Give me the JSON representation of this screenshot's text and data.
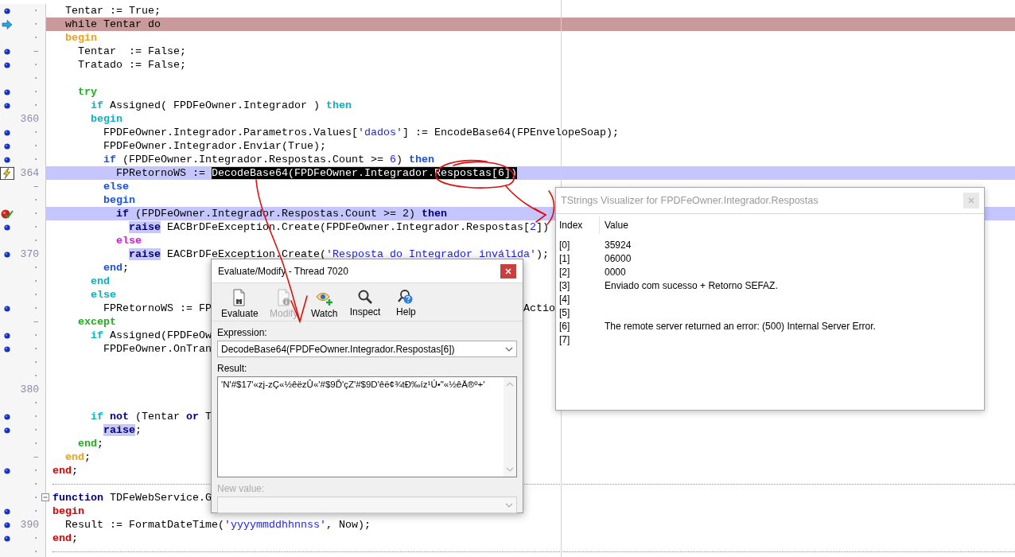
{
  "editor": {
    "lines": [
      {
        "gutter": "·",
        "marker": {
          "kind": "dot"
        },
        "segments": [
          {
            "text": "  Tentar := True;",
            "kind": "plain"
          }
        ]
      },
      {
        "gutter": "·",
        "marker": {
          "kind": "arrow"
        },
        "current": true,
        "segments": [
          {
            "text": "  while Tentar do",
            "kind": "plain"
          }
        ]
      },
      {
        "gutter": "·",
        "segments": [
          {
            "text": "  begin",
            "kind": "keyword",
            "color": "#f0a020"
          }
        ]
      },
      {
        "gutter": "–",
        "marker": {
          "kind": "dot"
        },
        "segments": [
          {
            "text": "    Tentar  := False;",
            "kind": "plain"
          }
        ]
      },
      {
        "gutter": "·",
        "marker": {
          "kind": "dot"
        },
        "segments": [
          {
            "text": "    Tratado := False;",
            "kind": "plain"
          }
        ]
      },
      {
        "gutter": "·"
      },
      {
        "gutter": "·",
        "marker": {
          "kind": "dot"
        },
        "segments": [
          {
            "text": "    try",
            "kind": "keyword",
            "color": "#20b020"
          }
        ]
      },
      {
        "gutter": "·",
        "marker": {
          "kind": "dot"
        },
        "segments": [
          {
            "text": "      if",
            "kind": "keyword",
            "color": "#10b0c0"
          },
          {
            "text": " Assigned( FPDFeOwner.Integrador ) ",
            "kind": "plain"
          },
          {
            "text": "then",
            "kind": "keyword",
            "color": "#10b0c0"
          }
        ]
      },
      {
        "gutter": "360",
        "segments": [
          {
            "text": "      begin",
            "kind": "keyword",
            "color": "#10b0c0"
          }
        ]
      },
      {
        "gutter": "·",
        "marker": {
          "kind": "dot"
        },
        "segments": [
          {
            "text": "        FPDFeOwner.Integrador.Parametros.Values[",
            "kind": "plain"
          },
          {
            "text": "'dados'",
            "kind": "string"
          },
          {
            "text": "] := EncodeBase64(FPEnvelopeSoap);",
            "kind": "plain"
          }
        ]
      },
      {
        "gutter": "·",
        "marker": {
          "kind": "dot"
        },
        "segments": [
          {
            "text": "        FPDFeOwner.Integrador.Enviar(True);",
            "kind": "plain"
          }
        ]
      },
      {
        "gutter": "·",
        "marker": {
          "kind": "dot"
        },
        "segments": [
          {
            "text": "        if",
            "kind": "keyword",
            "color": "#1a4ff0"
          },
          {
            "text": " (FPDFeOwner.Integrador.Respostas.Count >= ",
            "kind": "plain"
          },
          {
            "text": "6",
            "kind": "number"
          },
          {
            "text": ") ",
            "kind": "plain"
          },
          {
            "text": "then",
            "kind": "keyword",
            "color": "#1a4ff0"
          }
        ]
      },
      {
        "gutter": "364",
        "marker": {
          "kind": "lightning"
        },
        "breakpoint": true,
        "segments": [
          {
            "text": "          FPRetornoWS := ",
            "kind": "plain"
          },
          {
            "text": "DecodeBase64(FPDFeOwner.Integrador.Respostas[6])",
            "kind": "selected"
          }
        ]
      },
      {
        "gutter": "–",
        "segments": [
          {
            "text": "        else",
            "kind": "keyword",
            "color": "#1a4ff0"
          }
        ]
      },
      {
        "gutter": "·",
        "segments": [
          {
            "text": "        begin",
            "kind": "keyword",
            "color": "#1a4ff0"
          }
        ]
      },
      {
        "gutter": "·",
        "marker": {
          "kind": "check"
        },
        "breakpoint": true,
        "segments": [
          {
            "text": "          if",
            "kind": "reserved"
          },
          {
            "text": " (FPDFeOwner.Integrador.Respostas.Count >= 2) ",
            "kind": "plain"
          },
          {
            "text": "then",
            "kind": "reserved"
          }
        ]
      },
      {
        "gutter": "·",
        "marker": {
          "kind": "dot"
        },
        "segments": [
          {
            "text": "            raise",
            "kind": "match"
          },
          {
            "text": " EACBrDFeException.Create(FPDFeOwner.Integrador.Respostas[",
            "kind": "plain"
          },
          {
            "text": "2",
            "kind": "number"
          },
          {
            "text": "])",
            "kind": "plain"
          }
        ]
      },
      {
        "gutter": "·",
        "segments": [
          {
            "text": "          else",
            "kind": "keyword",
            "color": "#d020d0"
          }
        ]
      },
      {
        "gutter": "370",
        "marker": {
          "kind": "dot"
        },
        "segments": [
          {
            "text": "            raise",
            "kind": "match"
          },
          {
            "text": " EACBrDFeException.Create(",
            "kind": "plain"
          },
          {
            "text": "'Resposta do Integrador inválida'",
            "kind": "string"
          },
          {
            "text": ");",
            "kind": "plain"
          }
        ]
      },
      {
        "gutter": "·",
        "segments": [
          {
            "text": "        end",
            "kind": "keyword",
            "color": "#1a4ff0"
          },
          {
            "text": ";",
            "kind": "plain"
          }
        ]
      },
      {
        "gutter": "·",
        "segments": [
          {
            "text": "      end",
            "kind": "keyword",
            "color": "#10b0c0"
          }
        ]
      },
      {
        "gutter": "·",
        "segments": [
          {
            "text": "      else",
            "kind": "keyword",
            "color": "#10b0c0"
          }
        ]
      },
      {
        "gutter": "·",
        "marker": {
          "kind": "dot"
        },
        "segments": [
          {
            "text": "        FPRetornoWS := FP",
            "kind": "plain"
          }
        ],
        "tail": "Actio"
      },
      {
        "gutter": "–",
        "segments": [
          {
            "text": "    except",
            "kind": "keyword",
            "color": "#20b020"
          }
        ]
      },
      {
        "gutter": "·",
        "marker": {
          "kind": "dot"
        },
        "segments": [
          {
            "text": "      if",
            "kind": "keyword",
            "color": "#10b0c0"
          },
          {
            "text": " Assigned(FPDFeOw",
            "kind": "plain"
          }
        ]
      },
      {
        "gutter": "·",
        "marker": {
          "kind": "dot"
        },
        "segments": [
          {
            "text": "        FPDFeOwner.OnTran",
            "kind": "plain"
          }
        ]
      },
      {
        "gutter": "·"
      },
      {
        "gutter": "·"
      },
      {
        "gutter": "380"
      },
      {
        "gutter": "·"
      },
      {
        "gutter": "·",
        "marker": {
          "kind": "dot"
        },
        "segments": [
          {
            "text": "      if",
            "kind": "keyword",
            "color": "#10b0c0"
          },
          {
            "text": " not",
            "kind": "reserved"
          },
          {
            "text": " (Tentar ",
            "kind": "plain"
          },
          {
            "text": "or",
            "kind": "reserved"
          },
          {
            "text": " T",
            "kind": "plain"
          }
        ]
      },
      {
        "gutter": "·",
        "marker": {
          "kind": "dot"
        },
        "segments": [
          {
            "text": "        raise",
            "kind": "match"
          },
          {
            "text": ";",
            "kind": "plain"
          }
        ]
      },
      {
        "gutter": "·",
        "segments": [
          {
            "text": "    end",
            "kind": "keyword",
            "color": "#20b020"
          },
          {
            "text": ";",
            "kind": "plain"
          }
        ]
      },
      {
        "gutter": "–",
        "segments": [
          {
            "text": "  end",
            "kind": "keyword",
            "color": "#f0a020"
          },
          {
            "text": ";",
            "kind": "plain"
          }
        ]
      },
      {
        "gutter": "·",
        "marker": {
          "kind": "dot"
        },
        "segments": [
          {
            "text": "end",
            "kind": "keyword",
            "color": "#e00000"
          },
          {
            "text": ";",
            "kind": "plain"
          }
        ]
      },
      {
        "gutter": "·",
        "separator": true
      },
      {
        "gutter": "·",
        "fold": true,
        "segments": [
          {
            "text": "function",
            "kind": "reserved"
          },
          {
            "text": " TDFeWebService.G",
            "kind": "plain"
          }
        ]
      },
      {
        "gutter": "·",
        "marker": {
          "kind": "dot"
        },
        "segments": [
          {
            "text": "begin",
            "kind": "keyword",
            "color": "#e00000"
          }
        ]
      },
      {
        "gutter": "390",
        "marker": {
          "kind": "dot"
        },
        "segments": [
          {
            "text": "  Result := FormatDateTime(",
            "kind": "plain"
          },
          {
            "text": "'yyyymmddhhnnss'",
            "kind": "string"
          },
          {
            "text": ", Now);",
            "kind": "plain"
          }
        ]
      },
      {
        "gutter": "·",
        "marker": {
          "kind": "dot"
        },
        "segments": [
          {
            "text": "end",
            "kind": "keyword",
            "color": "#e00000"
          },
          {
            "text": ";",
            "kind": "plain"
          }
        ]
      },
      {
        "gutter": "·",
        "separator": true
      }
    ]
  },
  "evaluate_dialog": {
    "title": "Evaluate/Modify - Thread 7020",
    "active": true,
    "toolbar": [
      {
        "label": "Evaluate",
        "disabled": false
      },
      {
        "label": "Modify",
        "disabled": true
      },
      {
        "label": "Watch",
        "disabled": false
      },
      {
        "label": "Inspect",
        "disabled": false
      },
      {
        "label": "Help",
        "disabled": false
      }
    ],
    "expression": {
      "label": "Expression:",
      "value": "DecodeBase64(FPDFeOwner.Integrador.Respostas[6])"
    },
    "result": {
      "label": "Result:",
      "value": "'N'#$17'«zj-zÇ«½êëzÛ«'#$9Ď'çZ'#$9D'êë¢¾tÐ‰íz¹Ú•\"«½êÄ®º+'"
    },
    "new_value": {
      "label": "New value:",
      "disabled": true
    }
  },
  "visualizer": {
    "title": "TStrings Visualizer for FPDFeOwner.Integrador.Respostas",
    "active": false,
    "columns": [
      "Index",
      "Value"
    ],
    "rows": [
      {
        "index": "[0]",
        "value": "35924"
      },
      {
        "index": "[1]",
        "value": "06000"
      },
      {
        "index": "[2]",
        "value": "0000"
      },
      {
        "index": "[3]",
        "value": "Enviado com sucesso + Retorno SEFAZ."
      },
      {
        "index": "[4]"
      },
      {
        "index": "[5]"
      },
      {
        "index": "[6]",
        "value": "The remote server returned an error: (500) Internal Server Error."
      },
      {
        "index": "[7]"
      }
    ]
  }
}
